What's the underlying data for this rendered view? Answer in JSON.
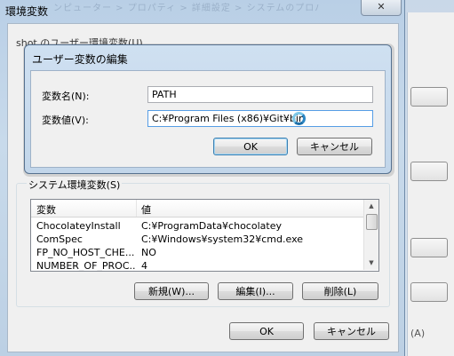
{
  "outer_window": {
    "title": "環境変数",
    "blurred_title": "ンピューター > プロパティ > 詳細設定 > システムのプロパティ",
    "close_icon": "close-icon",
    "user_section_label": "shot のユーザー環境変数(U)",
    "system_section_label": "システム環境変数(S)",
    "system_list": {
      "headers": [
        "変数",
        "値"
      ],
      "rows": [
        {
          "name": "ChocolateyInstall",
          "value": "C:¥ProgramData¥chocolatey"
        },
        {
          "name": "ComSpec",
          "value": "C:¥Windows¥system32¥cmd.exe"
        },
        {
          "name": "FP_NO_HOST_CHE...",
          "value": "NO"
        },
        {
          "name": "NUMBER_OF_PROC...",
          "value": "4"
        }
      ]
    },
    "buttons": {
      "new": "新規(W)...",
      "edit": "編集(I)...",
      "delete": "削除(L)",
      "ok": "OK",
      "cancel": "キャンセル"
    }
  },
  "edit_dialog": {
    "title": "ユーザー変数の編集",
    "name_label": "変数名(N):",
    "name_value": "PATH",
    "value_label": "変数値(V):",
    "value_value": "C:¥Program Files (x86)¥Git¥bin",
    "ok": "OK",
    "cancel": "キャンセル"
  },
  "background_window": {
    "partial_text": "(A)"
  }
}
